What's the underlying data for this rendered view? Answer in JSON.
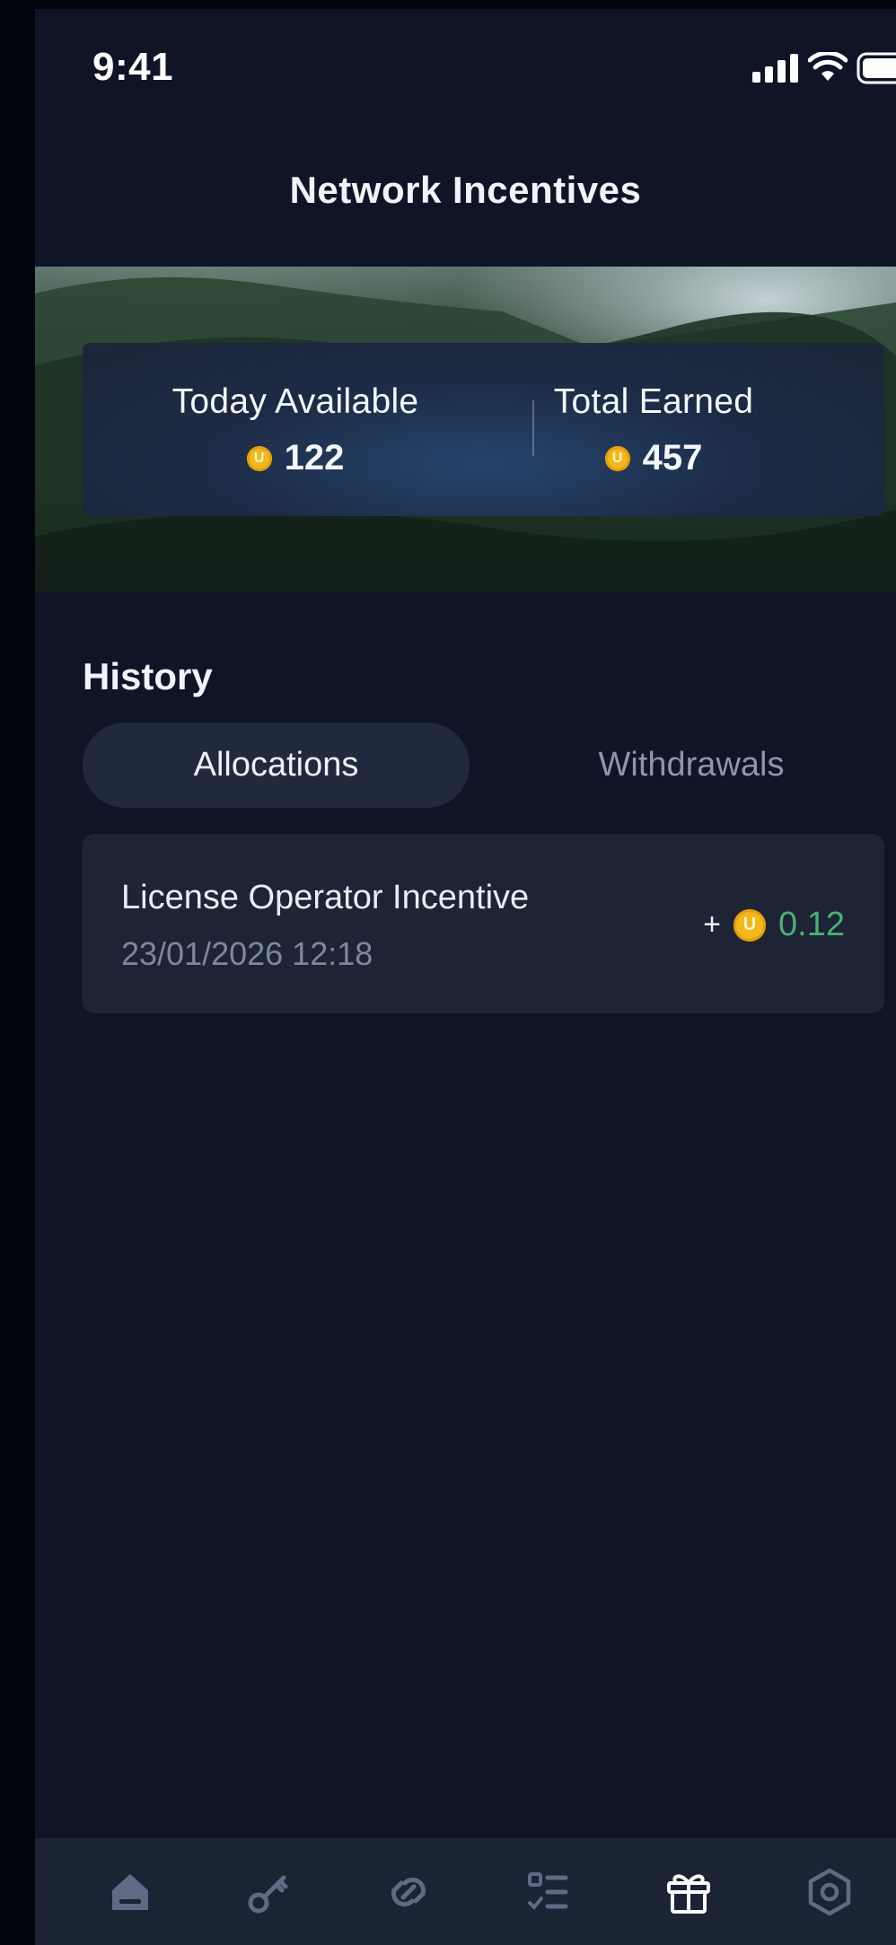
{
  "status_bar": {
    "time": "9:41"
  },
  "header": {
    "title": "Network Incentives"
  },
  "stats": {
    "today_available_label": "Today Available",
    "today_available_value": "122",
    "total_earned_label": "Total Earned",
    "total_earned_value": "457",
    "coin_symbol": "U"
  },
  "history": {
    "title": "History",
    "tabs": [
      {
        "label": "Allocations",
        "selected": true
      },
      {
        "label": "Withdrawals",
        "selected": false
      }
    ],
    "items": [
      {
        "title": "License Operator Incentive",
        "date": "23/01/2026 12:18",
        "sign": "+",
        "amount": "0.12"
      }
    ]
  },
  "bottom_nav": {
    "items": [
      {
        "icon": "home-icon",
        "active": false
      },
      {
        "icon": "key-icon",
        "active": false
      },
      {
        "icon": "link-icon",
        "active": false
      },
      {
        "icon": "task-list-icon",
        "active": false
      },
      {
        "icon": "gift-icon",
        "active": true
      },
      {
        "icon": "hexagon-settings-icon",
        "active": false
      }
    ]
  },
  "colors": {
    "background": "#0f1427",
    "card": "#1d2435",
    "coin": "#f5b81b",
    "positive": "#4caf72",
    "nav_inactive": "#5f6b84",
    "nav_active": "#ffffff"
  }
}
